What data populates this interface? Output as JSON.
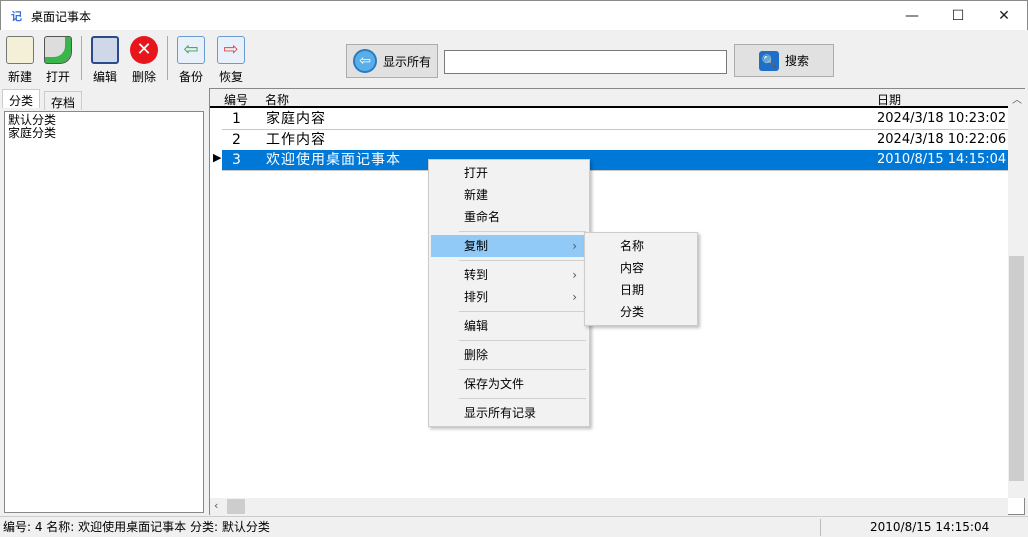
{
  "window": {
    "title": "桌面记事本",
    "icon": "记",
    "minimize": "—",
    "maximize": "☐",
    "close": "✕"
  },
  "toolbar": [
    {
      "label": "新建",
      "icon": "new-note-icon"
    },
    {
      "label": "打开",
      "icon": "open-icon"
    },
    {
      "label": "编辑",
      "icon": "edit-icon"
    },
    {
      "label": "删除",
      "icon": "delete-icon"
    },
    {
      "label": "备份",
      "icon": "backup-icon"
    },
    {
      "label": "恢复",
      "icon": "restore-icon"
    }
  ],
  "search": {
    "show_all_label": "显示所有",
    "value": "",
    "search_label": "搜索"
  },
  "left_tabs": [
    "分类",
    "存档"
  ],
  "categories": [
    "默认分类",
    "家庭分类"
  ],
  "grid": {
    "columns": [
      "编号",
      "名称",
      "日期"
    ],
    "rows": [
      {
        "id": "1",
        "name": "家庭内容",
        "date": "2024/3/18 10:23:02"
      },
      {
        "id": "2",
        "name": "工作内容",
        "date": "2024/3/18 10:22:06"
      },
      {
        "id": "3",
        "name": "欢迎使用桌面记事本",
        "date": "2010/8/15 14:15:04",
        "selected": true
      }
    ]
  },
  "context_menu": [
    "打开",
    "新建",
    "重命名",
    "复制",
    "转到",
    "排列",
    "编辑",
    "删除",
    "保存为文件",
    "显示所有记录"
  ],
  "submenu": [
    "名称",
    "内容",
    "日期",
    "分类"
  ],
  "status": {
    "left": "编号: 4  名称: 欢迎使用桌面记事本  分类: 默认分类",
    "right": "2010/8/15 14:15:04"
  },
  "colors": {
    "selection": "#0078d7",
    "menu_highlight": "#91c9f7"
  }
}
